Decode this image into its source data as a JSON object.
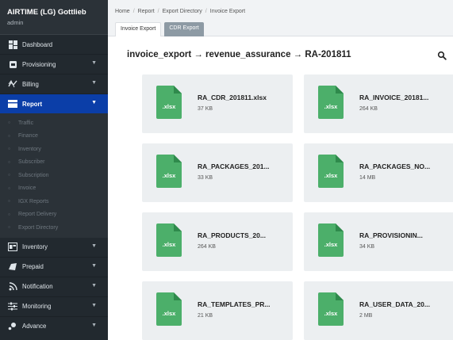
{
  "brand": {
    "title": "AIRTIME (LG) Gottlieb",
    "user": "admin"
  },
  "sidebar": {
    "items_top": [
      {
        "label": "Dashboard",
        "icon": "dashboard-icon",
        "chevron": false
      },
      {
        "label": "Provisioning",
        "icon": "provisioning-icon",
        "chevron": true
      },
      {
        "label": "Billing",
        "icon": "billing-icon",
        "chevron": true
      },
      {
        "label": "Report",
        "icon": "report-icon",
        "chevron": true,
        "active": true
      }
    ],
    "submenu": [
      "Traffic",
      "Finance",
      "Inventory",
      "Subscriber",
      "Subscription",
      "Invoice",
      "IGX Reports",
      "Report Delivery",
      "Export Directory"
    ],
    "items_bottom": [
      {
        "label": "Inventory",
        "icon": "inventory-icon",
        "chevron": true
      },
      {
        "label": "Prepaid",
        "icon": "prepaid-icon",
        "chevron": true
      },
      {
        "label": "Notification",
        "icon": "notification-icon",
        "chevron": true
      },
      {
        "label": "Monitoring",
        "icon": "monitoring-icon",
        "chevron": true
      },
      {
        "label": "Advance",
        "icon": "advance-icon",
        "chevron": true
      }
    ]
  },
  "breadcrumb": [
    "Home",
    "Report",
    "Export Directory",
    "Invoice Export"
  ],
  "tabs": [
    {
      "label": "Invoice Export",
      "active": true
    },
    {
      "label": "CDR Export",
      "active": false
    }
  ],
  "path_heading": "invoice_export → revenue_assurance → RA-201811",
  "files": [
    {
      "name": "RA_CDR_201811.xlsx",
      "size": "37 KB",
      "ext": ".xlsx"
    },
    {
      "name": "RA_INVOICE_20181...",
      "size": "264 KB",
      "ext": ".xlsx"
    },
    {
      "name": "RA_PACKAGES_201...",
      "size": "33 KB",
      "ext": ".xlsx"
    },
    {
      "name": "RA_PACKAGES_NO...",
      "size": "14 MB",
      "ext": ".xlsx"
    },
    {
      "name": "RA_PRODUCTS_20...",
      "size": "264 KB",
      "ext": ".xlsx"
    },
    {
      "name": "RA_PROVISIONIN...",
      "size": "34 KB",
      "ext": ".xlsx"
    },
    {
      "name": "RA_TEMPLATES_PR...",
      "size": "21 KB",
      "ext": ".xlsx"
    },
    {
      "name": "RA_USER_DATA_20...",
      "size": "2 MB",
      "ext": ".xlsx"
    }
  ],
  "colors": {
    "sidebar": "#22292f",
    "active": "#0b3ea8",
    "file_icon": "#4caf6a",
    "card": "#eceff1"
  }
}
